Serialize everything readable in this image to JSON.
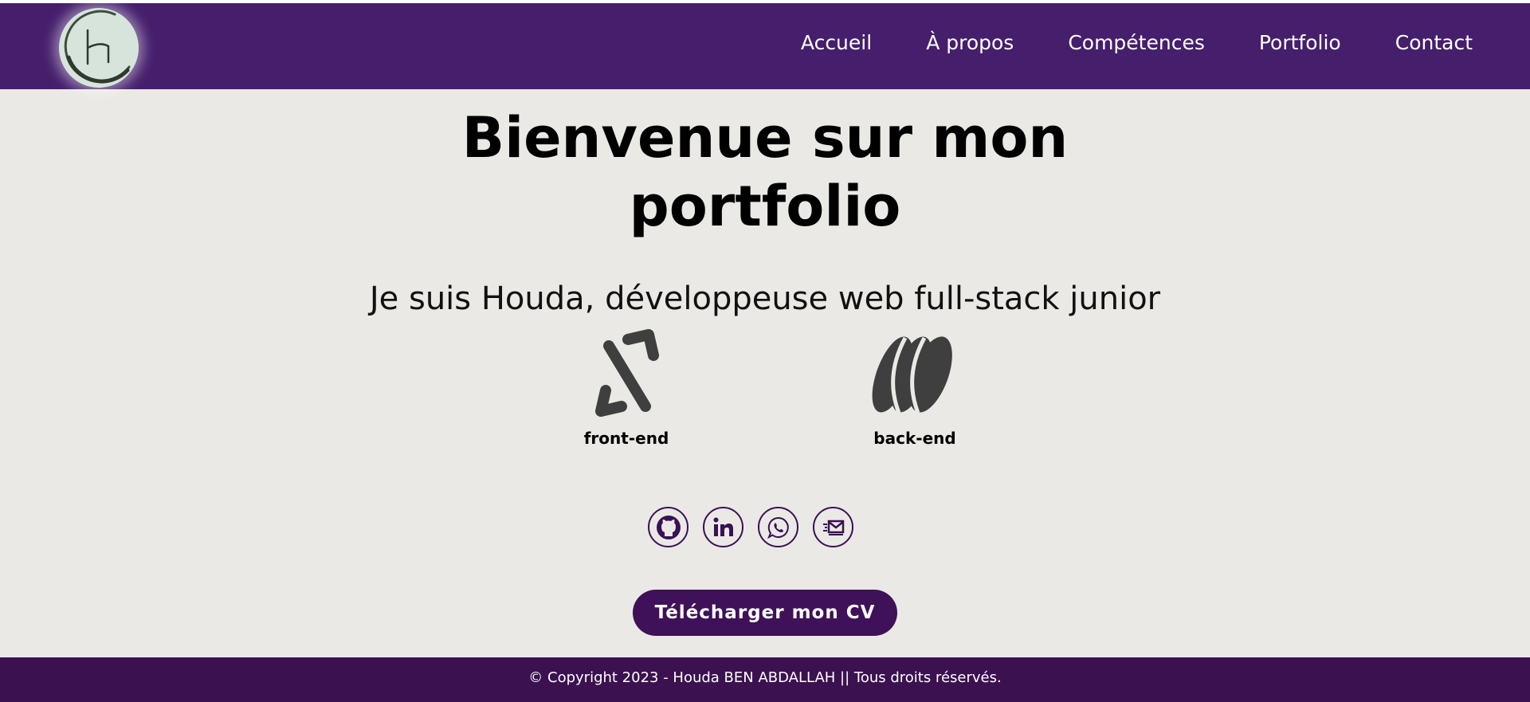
{
  "header": {
    "logo_letter": "H",
    "nav": [
      {
        "label": "Accueil"
      },
      {
        "label": "À propos"
      },
      {
        "label": "Compétences"
      },
      {
        "label": "Portfolio"
      },
      {
        "label": "Contact"
      }
    ]
  },
  "hero": {
    "title_line1": "Bienvenue sur mon",
    "title_line2": "portfolio",
    "subtitle": "Je suis Houda, développeuse web full-stack junior",
    "skills": [
      {
        "label": "front-end",
        "icon": "code-icon"
      },
      {
        "label": "back-end",
        "icon": "database-icon"
      }
    ],
    "socials": [
      {
        "icon": "github-icon"
      },
      {
        "icon": "linkedin-icon"
      },
      {
        "icon": "whatsapp-icon"
      },
      {
        "icon": "mail-icon"
      }
    ],
    "cv_button": "Télécharger mon CV"
  },
  "footer": {
    "text": "© Copyright 2023 - Houda BEN ABDALLAH || Tous droits réservés."
  },
  "colors": {
    "header_bg": "#451e6c",
    "footer_bg": "#3b1150",
    "page_bg": "#ebe9e5",
    "accent": "#3f1158",
    "icon_gray": "#3f3f3f"
  }
}
